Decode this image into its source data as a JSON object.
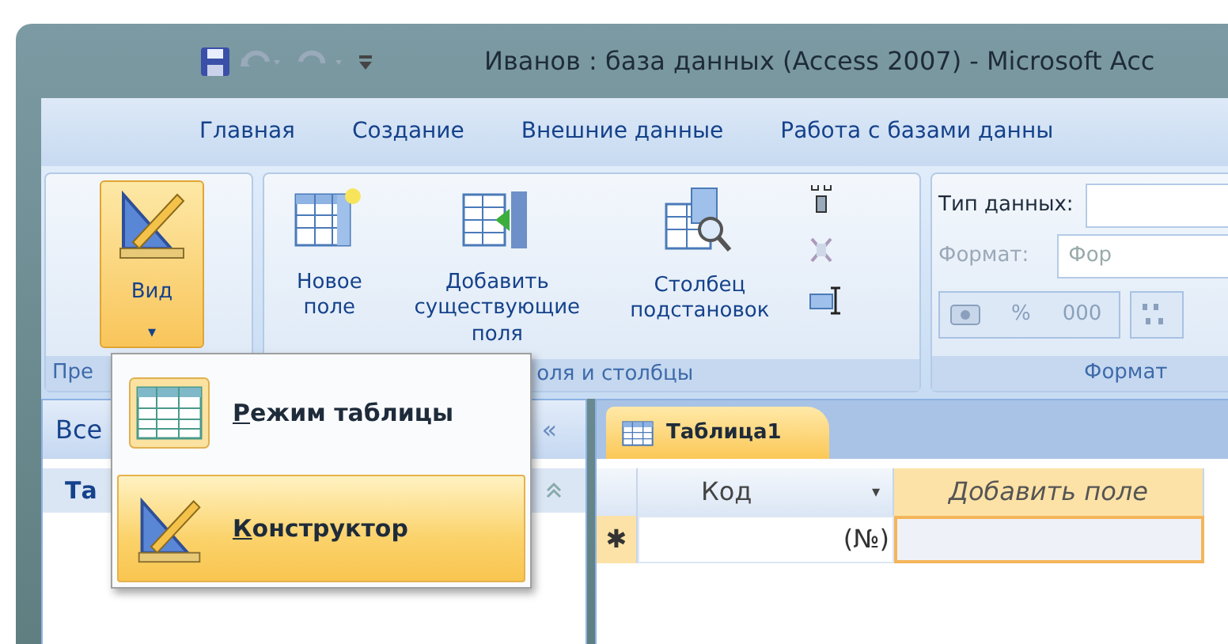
{
  "window": {
    "title": "Иванов : база данных (Access 2007) - Microsoft Acc"
  },
  "ribbon_tabs": [
    {
      "label": "Главная",
      "selected": false
    },
    {
      "label": "Создание",
      "selected": false
    },
    {
      "label": "Внешние данные",
      "selected": false
    },
    {
      "label": "Работа с базами данны",
      "selected": false
    }
  ],
  "views_group": {
    "label": "Пре",
    "button": {
      "label": "Вид",
      "caret": "▾",
      "pressed": true
    }
  },
  "fields_group": {
    "label": "оля и столбцы",
    "buttons": [
      {
        "lines": [
          "Новое",
          "поле"
        ]
      },
      {
        "lines": [
          "Добавить",
          "существующие поля"
        ]
      },
      {
        "lines": [
          "Столбец",
          "подстановок"
        ]
      }
    ]
  },
  "format_group": {
    "label": "Формат",
    "data_type": {
      "label": "Тип данных:"
    },
    "format": {
      "label": "Формат:",
      "value": "Фор",
      "disabled": true
    },
    "number_buttons": [
      {
        "label": "%"
      },
      {
        "label": "000"
      }
    ]
  },
  "view_menu": {
    "items": [
      {
        "kind": "datasheet",
        "access_key": "Р",
        "rest": "ежим таблицы",
        "selected": false
      },
      {
        "kind": "design",
        "access_key": "К",
        "rest": "онструктор",
        "selected": true
      }
    ]
  },
  "nav_pane": {
    "title": "Bce",
    "collapse": "«",
    "group": "Та"
  },
  "document_tabs": [
    {
      "label": "Таблица1",
      "selected": true
    }
  ],
  "datasheet": {
    "columns": [
      {
        "label": "Код",
        "kind": "field",
        "caret": "▾"
      },
      {
        "label": "Добавить поле",
        "kind": "add"
      }
    ],
    "rows": [
      {
        "selector": "✱",
        "cells": [
          "(№)"
        ]
      }
    ]
  }
}
